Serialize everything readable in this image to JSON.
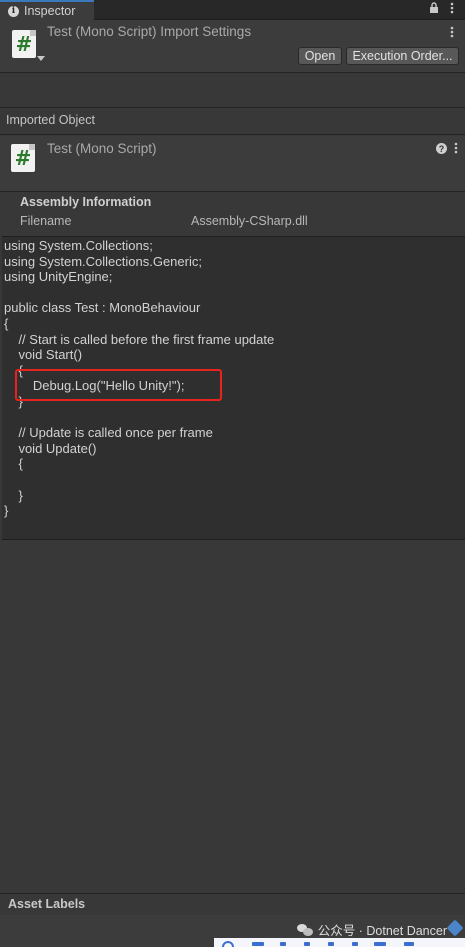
{
  "tab": {
    "label": "Inspector"
  },
  "header": {
    "title": "Test (Mono Script) Import Settings",
    "open_label": "Open",
    "execution_order_label": "Execution Order..."
  },
  "imported_object": {
    "label": "Imported Object",
    "title": "Test (Mono Script)"
  },
  "assembly": {
    "title": "Assembly Information",
    "filename_label": "Filename",
    "filename_value": "Assembly-CSharp.dll"
  },
  "code_lines": [
    "using System.Collections;",
    "using System.Collections.Generic;",
    "using UnityEngine;",
    "",
    "public class Test : MonoBehaviour",
    "{",
    "    // Start is called before the first frame update",
    "    void Start()",
    "    {",
    "        Debug.Log(\"Hello Unity!\");",
    "    }",
    "",
    "    // Update is called once per frame",
    "    void Update()",
    "    {",
    "",
    "    }",
    "}"
  ],
  "asset_labels": {
    "label": "Asset Labels"
  },
  "watermark": {
    "text": "公众号 · Dotnet Dancer"
  },
  "icons": {
    "script": "#",
    "info": "i",
    "help": "?"
  },
  "colors": {
    "highlight": "#e8231e",
    "tab_accent": "#3a79bb",
    "script_icon": "#2c7a2c"
  }
}
